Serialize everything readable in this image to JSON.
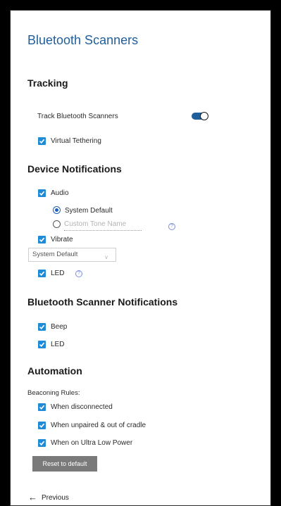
{
  "page": {
    "title": "Bluetooth Scanners"
  },
  "tracking": {
    "heading": "Tracking",
    "track_label": "Track Bluetooth Scanners",
    "track_enabled": true,
    "virtual_tethering_label": "Virtual Tethering",
    "virtual_tethering_checked": true
  },
  "device_notifications": {
    "heading": "Device Notifications",
    "audio_label": "Audio",
    "audio_checked": true,
    "system_default_label": "System Default",
    "custom_tone_placeholder": "Custom Tone Name",
    "vibrate_label": "Vibrate",
    "vibrate_checked": true,
    "vibrate_select_value": "System Default",
    "led_label": "LED",
    "led_checked": true,
    "help_glyph": "?"
  },
  "scanner_notifications": {
    "heading": "Bluetooth Scanner Notifications",
    "beep_label": "Beep",
    "beep_checked": true,
    "led_label": "LED",
    "led_checked": true
  },
  "automation": {
    "heading": "Automation",
    "beaconing_rules_label": "Beaconing Rules:",
    "rules": [
      {
        "label": "When disconnected",
        "checked": true
      },
      {
        "label": "When unpaired & out of cradle",
        "checked": true
      },
      {
        "label": "When on Ultra Low Power",
        "checked": true
      }
    ],
    "reset_label": "Reset to default"
  },
  "footer": {
    "previous_label": "Previous",
    "previous_arrow": "←"
  },
  "colors": {
    "accent": "#1f8ad6",
    "title": "#1f5f9c",
    "button": "#7a7a7a"
  }
}
